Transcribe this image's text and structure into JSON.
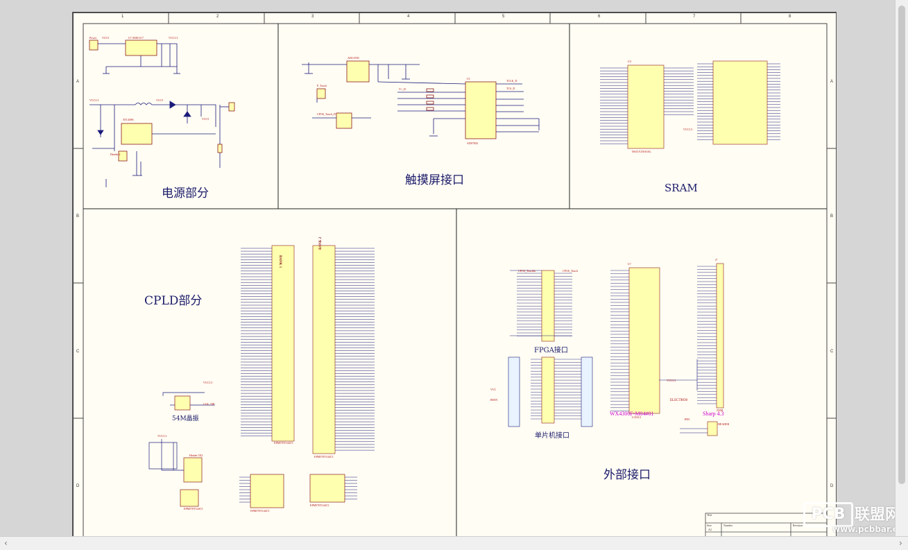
{
  "sections": {
    "power": "电源部分",
    "touch": "触摸屏接口",
    "sram": "SRAM",
    "cpld": "CPLD部分",
    "external": "外部接口"
  },
  "sublabels": {
    "fpga": "FPGA接口",
    "mcu": "单片机接口",
    "lcd_module": "WX4300F-M04#01",
    "sharp": "Sharp 4.3",
    "osc": "54M晶振",
    "electros": "ELECTRO8",
    "bank1": "BANK 1",
    "bank2": "BANK 2",
    "ams1117": "U? AMS1117",
    "ads7843": "ADS7843",
    "sram_chip": "IS61LV25616AL"
  },
  "border": {
    "cols": [
      "1",
      "2",
      "3",
      "4",
      "5",
      "6",
      "7",
      "8"
    ],
    "rows": [
      "A",
      "B",
      "C",
      "D"
    ]
  },
  "title_block": {
    "title": "Title",
    "size": "Size",
    "size_value": "A2",
    "number": "Number",
    "revision": "Revision"
  },
  "watermark": {
    "logo": "PCB",
    "name": "联盟网",
    "url": "www.pcbbar.com"
  },
  "scroll": {
    "left": "‹",
    "right": "›"
  },
  "colors": {
    "wire": "#1a1a7a",
    "part_fill": "#ffffb0",
    "part_border": "#8b1a1a",
    "net_label": "#b01010",
    "power": "#cc1010",
    "magenta": "#cc00cc"
  }
}
